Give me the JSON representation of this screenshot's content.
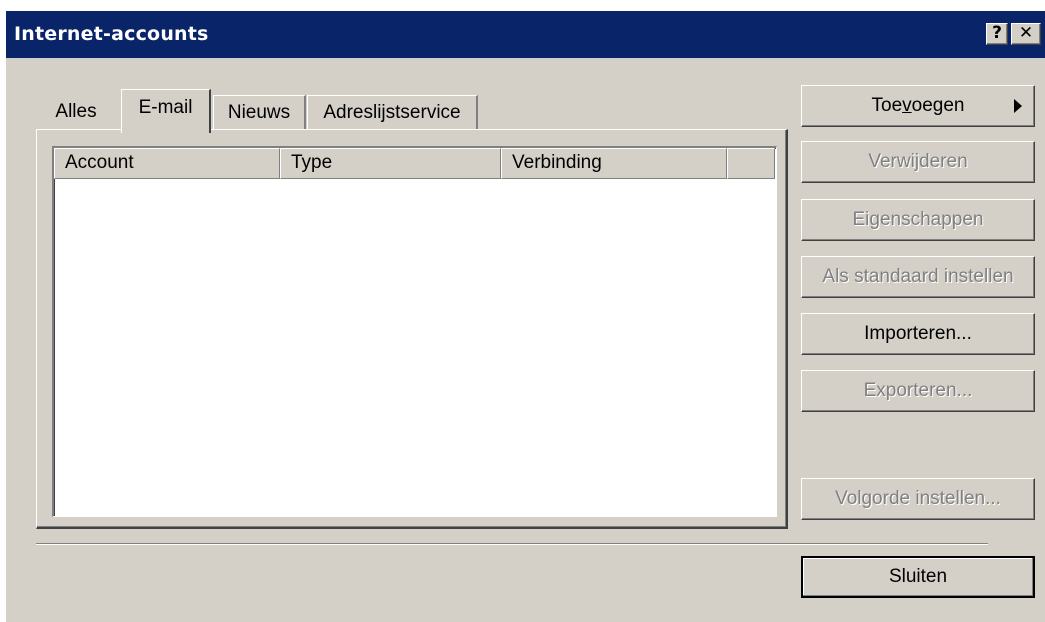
{
  "window": {
    "title": "Internet-accounts",
    "help_glyph": "?",
    "close_glyph": "✕"
  },
  "tabs": [
    {
      "label": "Alles",
      "active": false
    },
    {
      "label": "E-mail",
      "active": true
    },
    {
      "label": "Nieuws",
      "active": false
    },
    {
      "label": "Adreslijstservice",
      "active": false
    }
  ],
  "list": {
    "columns": [
      "Account",
      "Type",
      "Verbinding",
      ""
    ],
    "rows": []
  },
  "buttons": {
    "add": {
      "prefix": "Toe",
      "mnemonic": "v",
      "suffix": "oegen",
      "enabled": true
    },
    "remove": {
      "label": "Verwijderen",
      "enabled": false
    },
    "properties": {
      "label": "Eigenschappen",
      "enabled": false
    },
    "set_default": {
      "label": "Als standaard instellen",
      "enabled": false
    },
    "import": {
      "label": "Importeren...",
      "enabled": true
    },
    "export": {
      "label": "Exporteren...",
      "enabled": false
    },
    "set_order": {
      "label": "Volgorde instellen...",
      "enabled": false
    },
    "close": {
      "label": "Sluiten",
      "enabled": true
    }
  },
  "colors": {
    "titlebar": "#0a246a",
    "face": "#d4d0c8",
    "disabled_text": "#808080"
  }
}
